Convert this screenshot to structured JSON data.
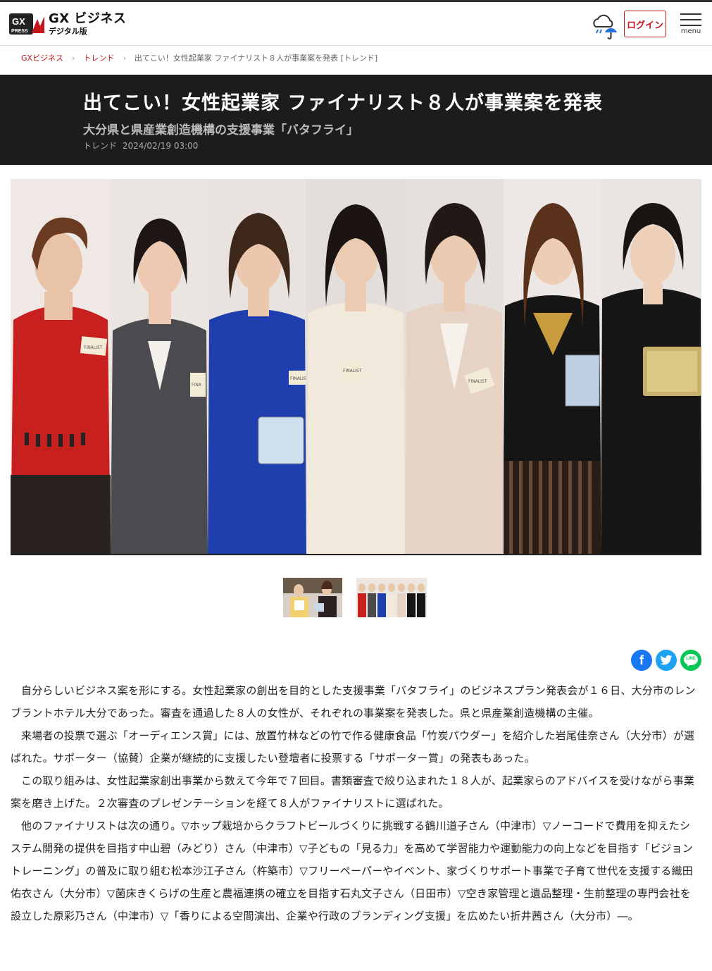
{
  "header": {
    "logo_main": "GX ビジネス",
    "logo_sub": "デジタル版",
    "logo_badge_line1": "GX",
    "logo_badge_line2": "PRESS",
    "login_label": "ログイン",
    "menu_label": "menu"
  },
  "breadcrumb": {
    "home": "GXビジネス",
    "section": "トレンド",
    "current": "出てこい！女性起業家 ファイナリスト８人が事業案を発表 [トレンド]",
    "separator": "›"
  },
  "article": {
    "title": "出てこい！女性起業家 ファイナリスト８人が事業案を発表",
    "subtitle": "大分県と県産業創造機構の支援事業「バタフライ」",
    "category": "トレンド",
    "datetime": "2024/02/19 03:00",
    "paragraphs": [
      "自分らしいビジネス案を形にする。女性起業家の創出を目的とした支援事業「バタフライ」のビジネスプラン発表会が１６日、大分市のレンブラントホテル大分であった。審査を通過した８人の女性が、それぞれの事業案を発表した。県と県産業創造機構の主催。",
      "来場者の投票で選ぶ「オーディエンス賞」には、放置竹林などの竹で作る健康食品「竹炭パウダー」を紹介した岩尾佳奈さん（大分市）が選ばれた。サポーター（協賛）企業が継続的に支援したい登壇者に投票する「サポーター賞」の発表もあった。",
      "この取り組みは、女性起業家創出事業から数えて今年で７回目。書類審査で絞り込まれた１８人が、起業家らのアドバイスを受けながら事業案を磨き上げた。２次審査のプレゼンテーションを経て８人がファイナリストに選ばれた。",
      "他のファイナリストは次の通り。▽ホップ栽培からクラフトビールづくりに挑戦する鶴川道子さん（中津市）▽ノーコードで費用を抑えたシステム開発の提供を目指す中山碧（みどり）さん（中津市）▽子どもの「見る力」を高めて学習能力や運動能力の向上などを目指す「ビジョントレーニング」の普及に取り組む松本沙江子さん（杵築市）▽フリーペーパーやイベント、家づくりサポート事業で子育て世代を支援する織田佑衣さん（大分市）▽菌床きくらげの生産と農福連携の確立を目指す石丸文子さん（日田市）▽空き家管理と遺品整理・生前整理の専門会社を設立した原彩乃さん（中津市）▽「香りによる空間演出、企業や行政のブランディング支援」を広めたい折井茜さん（大分市）―。"
    ]
  },
  "photo": {
    "badge_texts": [
      "FINALIST",
      "FINA",
      "FINALIST",
      "FINALIST",
      "FINALIST"
    ]
  },
  "share": {
    "facebook": "f",
    "twitter": "t",
    "line": "LINE"
  },
  "colors": {
    "accent": "#c4161c",
    "band": "#1c1c1c",
    "facebook": "#1877f2",
    "twitter": "#1da1f2",
    "line": "#06c755"
  }
}
